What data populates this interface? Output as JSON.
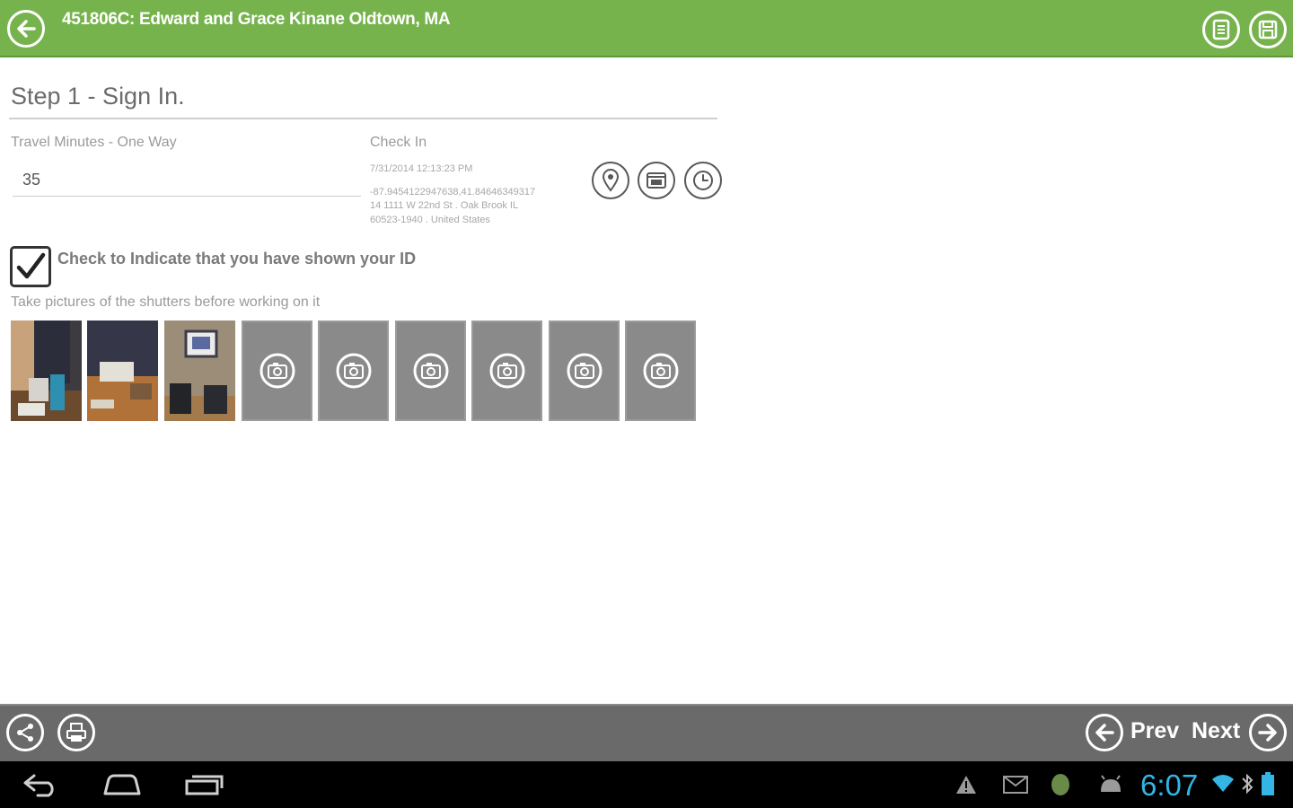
{
  "header": {
    "title": "451806C: Edward  and  Grace Kinane Oldtown, MA"
  },
  "step": {
    "title": "Step 1 - Sign In."
  },
  "travel": {
    "label": "Travel Minutes - One Way",
    "value": "35"
  },
  "checkin": {
    "label": "Check In",
    "timestamp": "7/31/2014 12:13:23 PM",
    "coords": "-87.9454122947638,41.84646349317",
    "address_line1": "14 1111 W 22nd St . Oak Brook IL",
    "address_line2": "60523-1940 . United States"
  },
  "id_check": {
    "label": "Check to Indicate that you have shown your ID",
    "checked": true
  },
  "photos": {
    "label": "Take pictures of the shutters before working on it",
    "taken_count": 3,
    "empty_count": 6
  },
  "footer": {
    "prev_label": "Prev",
    "next_label": "Next"
  },
  "system": {
    "time": "6:07"
  },
  "colors": {
    "header_green": "#76b34c",
    "footer_gray": "#6a6a6a",
    "clock_blue": "#33b5e5",
    "empty_photo": "#8a8a8a"
  },
  "icons": {
    "back": "back-arrow-icon",
    "notes": "document-icon",
    "save": "save-icon",
    "location": "location-pin-icon",
    "card": "id-card-icon",
    "clock": "clock-icon",
    "camera": "camera-icon",
    "share": "share-icon",
    "print": "print-icon"
  }
}
